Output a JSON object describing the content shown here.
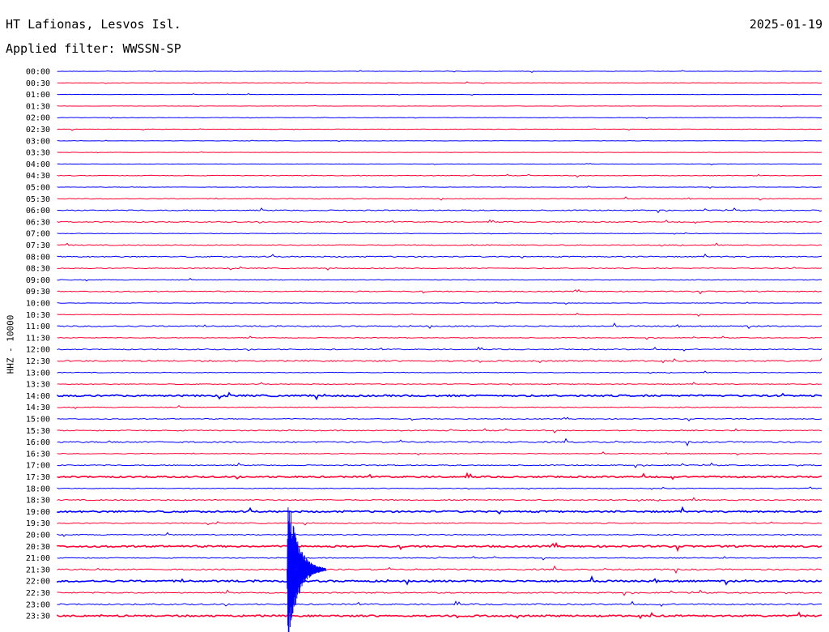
{
  "header": {
    "station": "HT Lafionas, Lesvos Isl.",
    "date": "2025-01-19",
    "filter": "Applied filter: WWSSN-SP"
  },
  "chart_data": {
    "type": "line",
    "title": "HT Lafionas, Lesvos Isl.",
    "ylabel": "HHZ - 10000",
    "rows": [
      "00:00",
      "00:30",
      "01:00",
      "01:30",
      "02:00",
      "02:30",
      "03:00",
      "03:30",
      "04:00",
      "04:30",
      "05:00",
      "05:30",
      "06:00",
      "06:30",
      "07:00",
      "07:30",
      "08:00",
      "08:30",
      "09:00",
      "09:30",
      "10:00",
      "10:30",
      "11:00",
      "11:30",
      "12:00",
      "12:30",
      "13:00",
      "13:30",
      "14:00",
      "14:30",
      "15:00",
      "15:30",
      "16:00",
      "16:30",
      "17:00",
      "17:30",
      "18:00",
      "18:30",
      "19:00",
      "19:30",
      "20:00",
      "20:30",
      "21:00",
      "21:30",
      "22:00",
      "22:30",
      "23:00",
      "23:30"
    ],
    "colors": {
      "even": "#0000ff",
      "odd": "#ff0033"
    },
    "event": {
      "description": "large seismic arrival",
      "row": "21:30",
      "minute_offset": 9.0,
      "peak_amplitude_rows": 7.5
    },
    "noise_level_by_row": [
      0.5,
      0.5,
      0.4,
      0.4,
      0.5,
      0.6,
      0.4,
      0.4,
      0.4,
      0.8,
      0.5,
      0.9,
      1.2,
      1.1,
      0.6,
      1.1,
      1.3,
      1.0,
      0.8,
      1.2,
      0.6,
      0.7,
      1.4,
      0.8,
      1.2,
      1.6,
      0.8,
      0.9,
      2.0,
      1.0,
      1.0,
      1.2,
      1.6,
      0.8,
      1.2,
      1.8,
      0.9,
      1.3,
      2.0,
      1.1,
      1.2,
      2.0,
      1.0,
      1.6,
      2.0,
      1.4,
      1.6,
      2.0
    ]
  }
}
